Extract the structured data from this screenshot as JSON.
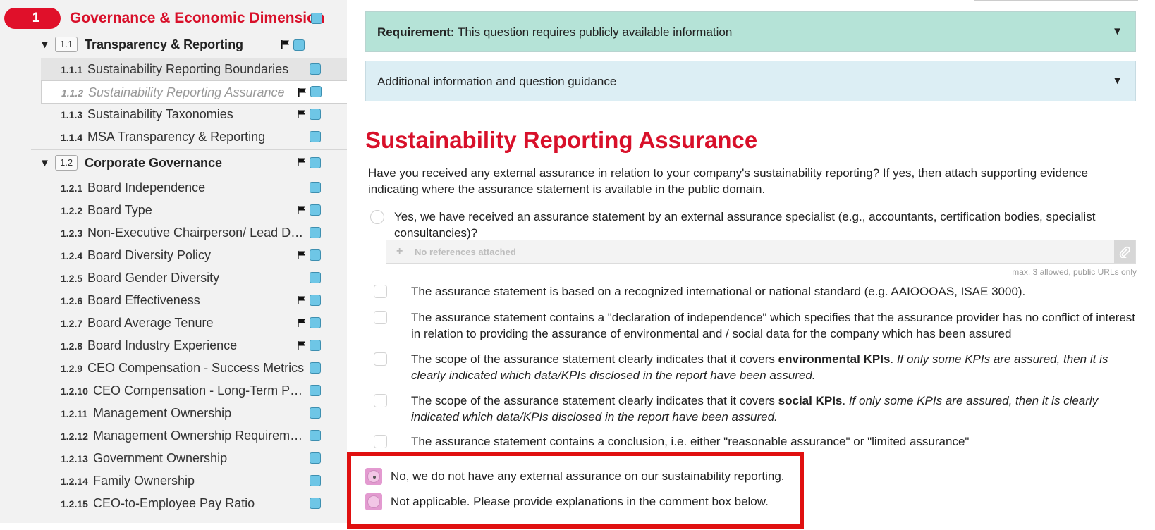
{
  "sidebar": {
    "dimension": {
      "number": "1",
      "title": "Governance & Economic Dimension"
    },
    "groups": [
      {
        "code": "1.1",
        "title": "Transparency & Reporting",
        "items": [
          {
            "code": "1.1.1",
            "label": "Sustainability Reporting Boundaries"
          },
          {
            "code": "1.1.2",
            "label": "Sustainability Reporting Assurance"
          },
          {
            "code": "1.1.3",
            "label": "Sustainability Taxonomies"
          },
          {
            "code": "1.1.4",
            "label": "MSA Transparency & Reporting"
          }
        ]
      },
      {
        "code": "1.2",
        "title": "Corporate Governance",
        "items": [
          {
            "code": "1.2.1",
            "label": "Board Independence"
          },
          {
            "code": "1.2.2",
            "label": "Board Type"
          },
          {
            "code": "1.2.3",
            "label": "Non-Executive Chairperson/ Lead Director"
          },
          {
            "code": "1.2.4",
            "label": "Board Diversity Policy"
          },
          {
            "code": "1.2.5",
            "label": "Board Gender Diversity"
          },
          {
            "code": "1.2.6",
            "label": "Board Effectiveness"
          },
          {
            "code": "1.2.7",
            "label": "Board Average Tenure"
          },
          {
            "code": "1.2.8",
            "label": "Board Industry Experience"
          },
          {
            "code": "1.2.9",
            "label": "CEO Compensation - Success Metrics"
          },
          {
            "code": "1.2.10",
            "label": "CEO Compensation - Long-Term Performance"
          },
          {
            "code": "1.2.11",
            "label": "Management Ownership"
          },
          {
            "code": "1.2.12",
            "label": "Management Ownership Requirements"
          },
          {
            "code": "1.2.13",
            "label": "Government Ownership"
          },
          {
            "code": "1.2.14",
            "label": "Family Ownership"
          },
          {
            "code": "1.2.15",
            "label": "CEO-to-Employee Pay Ratio"
          }
        ]
      }
    ]
  },
  "main": {
    "requirement_label": "Requirement:",
    "requirement_text": "This question requires publicly available information",
    "guidance_text": "Additional information and question guidance",
    "question_title": "Sustainability Reporting Assurance",
    "question_text": "Have you received any external assurance in relation to your company's sustainability reporting? If yes, then attach supporting evidence indicating where the assurance statement is available in the public domain.",
    "option_yes": "Yes, we have received an assurance statement by an external assurance specialist (e.g., accountants, certification bodies, specialist consultancies)?",
    "references_placeholder": "No references attached",
    "references_hint": "max. 3 allowed, public URLs only",
    "checkboxes": [
      {
        "text": "The assurance statement is based on a recognized international or national standard (e.g. AAIOOOAS, ISAE 3000)."
      },
      {
        "text": "The assurance statement contains a \"declaration of independence\" which specifies that the assurance provider has no conflict of interest in relation to providing the assurance of environmental and / social data for the company which has been assured"
      },
      {
        "pre": "The scope of the assurance statement clearly indicates that it covers ",
        "bold": "environmental KPIs",
        "post": ". ",
        "italic": "If only some KPIs are assured, then it is clearly indicated which data/KPIs disclosed in the report have been assured."
      },
      {
        "pre": "The scope of the assurance statement clearly indicates that it covers ",
        "bold": "social KPIs",
        "post": ". ",
        "italic": "If only some KPIs are assured, then it is clearly indicated which data/KPIs disclosed in the report have been assured."
      },
      {
        "text": "The assurance statement contains a conclusion, i.e. either \"reasonable assurance\" or \"limited assurance\""
      }
    ],
    "option_no": "No, we do not have any external assurance on our sustainability reporting.",
    "option_na": "Not applicable. Please provide explanations in the comment box below."
  },
  "colors": {
    "accent": "#d8102a",
    "requirement_bg": "#b5e3d7",
    "guidance_bg": "#dceef4",
    "highlight": "#e01010"
  }
}
